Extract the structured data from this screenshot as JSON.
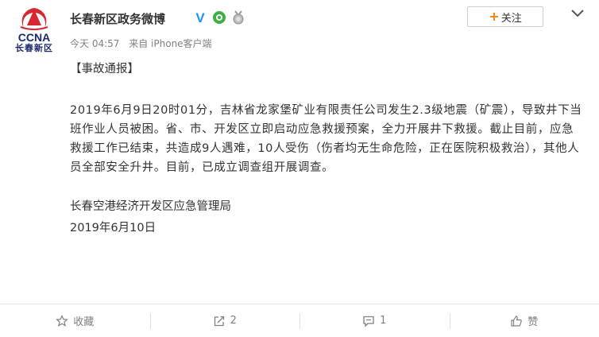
{
  "author": {
    "name": "长春新区政务微博",
    "logo_text": "CCNA",
    "logo_subtext": "长春新区"
  },
  "meta": {
    "time": "今天 04:57",
    "source": "来自 iPhone客户端"
  },
  "follow_button": {
    "plus": "+",
    "label": "关注"
  },
  "post": {
    "tag": "【事故通报】",
    "paragraph": "2019年6月9日20时01分，吉林省龙家堡矿业有限责任公司发生2.3级地震（矿震），导致井下当班作业人员被困。省、市、开发区立即启动应急救援预案，全力开展井下救援。截止目前，应急救援工作已结束，共造成9人遇难，10人受伤（伤者均无生命危险，正在医院积极救治），其他人员全部安全升井。目前，已成立调查组开展调查。",
    "signer": "长春空港经济开发区应急管理局",
    "date": "2019年6月10日"
  },
  "actions": {
    "favorite_label": "收藏",
    "repost_count": "2",
    "comment_count": "1",
    "like_label": "赞"
  },
  "colors": {
    "accent": "#ff8200",
    "text": "#333333",
    "muted": "#808080",
    "logo_blue": "#1a2a6c",
    "logo_red": "#d7282f"
  },
  "icons": [
    "verified-icon",
    "vip-icon",
    "medal-icon",
    "more-chevron-icon",
    "star-icon",
    "repost-icon",
    "comment-icon",
    "like-icon"
  ]
}
